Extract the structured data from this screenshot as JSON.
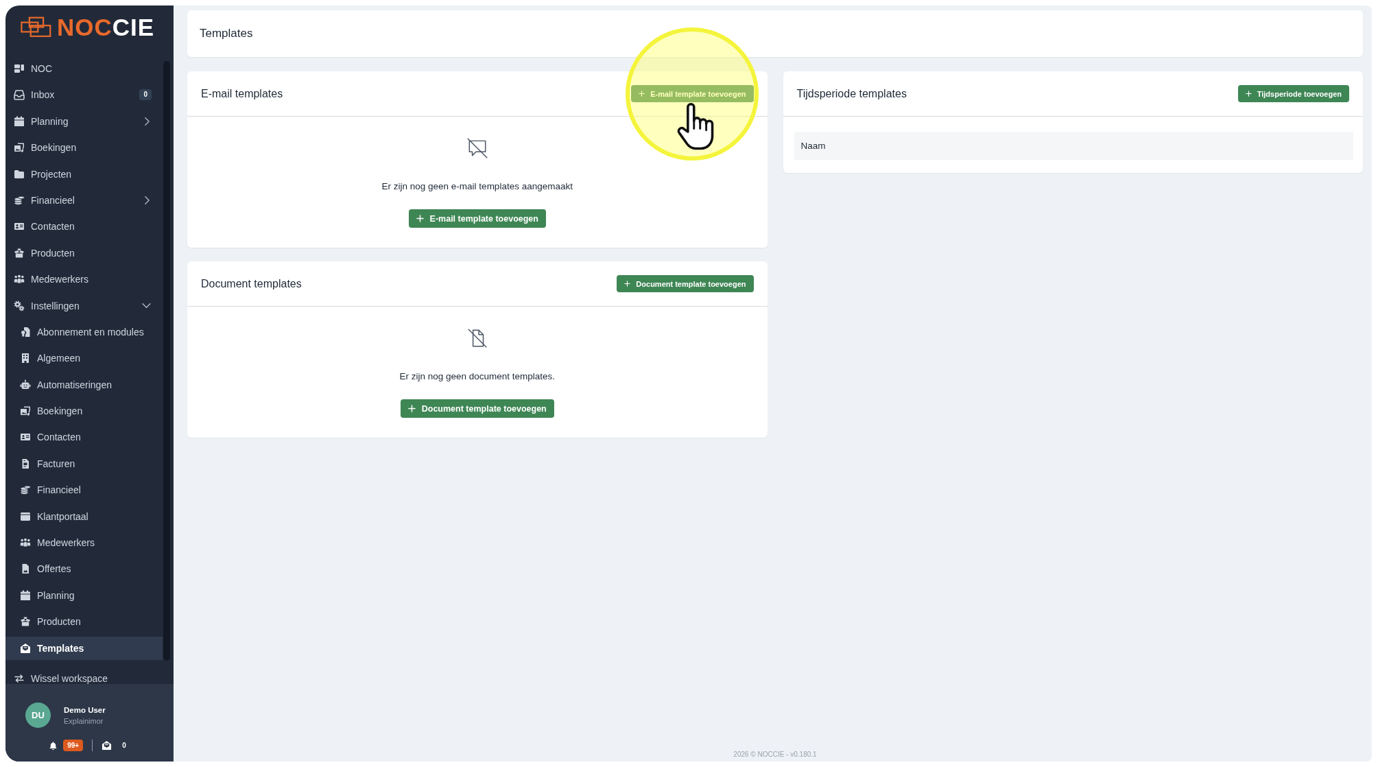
{
  "logo": {
    "accent": "NOC",
    "rest": "CIE"
  },
  "sidebar": {
    "items": [
      {
        "label": "NOC",
        "kind": "link",
        "selected": false
      },
      {
        "label": "Inbox",
        "kind": "link",
        "selected": false,
        "badge": "0"
      },
      {
        "label": "Planning",
        "kind": "group",
        "selected": false,
        "expanded": false
      },
      {
        "label": "Boekingen",
        "kind": "link",
        "selected": false
      },
      {
        "label": "Projecten",
        "kind": "link",
        "selected": false
      },
      {
        "label": "Financieel",
        "kind": "group",
        "selected": false,
        "expanded": false
      },
      {
        "label": "Contacten",
        "kind": "link",
        "selected": false
      },
      {
        "label": "Producten",
        "kind": "link",
        "selected": false
      },
      {
        "label": "Medewerkers",
        "kind": "link",
        "selected": false
      },
      {
        "label": "Instellingen",
        "kind": "group",
        "selected": false,
        "expanded": true,
        "children": [
          {
            "label": "Abonnement en modules",
            "selected": false
          },
          {
            "label": "Algemeen",
            "selected": false
          },
          {
            "label": "Automatiseringen",
            "selected": false
          },
          {
            "label": "Boekingen",
            "selected": false
          },
          {
            "label": "Contacten",
            "selected": false
          },
          {
            "label": "Facturen",
            "selected": false
          },
          {
            "label": "Financieel",
            "selected": false
          },
          {
            "label": "Klantportaal",
            "selected": false
          },
          {
            "label": "Medewerkers",
            "selected": false
          },
          {
            "label": "Offertes",
            "selected": false
          },
          {
            "label": "Planning",
            "selected": false
          },
          {
            "label": "Producten",
            "selected": false
          },
          {
            "label": "Templates",
            "selected": true
          }
        ]
      }
    ],
    "workspace_switch": "Wissel workspace",
    "user": {
      "initials": "DU",
      "name": "Demo User",
      "organization": "Explainimor",
      "notification_count": "99+",
      "message_count": "0"
    }
  },
  "page_title": "Templates",
  "columns": [
    {
      "cards": [
        {
          "kind": "empty",
          "title": "E-mail templates",
          "action": "E-mail template toevoegen",
          "action_highlighted": true,
          "message": "Er zijn nog geen e-mail templates aangemaakt",
          "button": "E-mail template toevoegen"
        },
        {
          "kind": "empty",
          "title": "Document templates",
          "action": "Document template toevoegen",
          "action_highlighted": false,
          "message": "Er zijn nog geen document templates.",
          "button": "Document template toevoegen"
        }
      ]
    },
    {
      "cards": [
        {
          "kind": "table",
          "title": "Tijdsperiode templates",
          "action": "Tijdsperiode toevoegen",
          "action_highlighted": false,
          "table": {
            "columns": [
              "Naam"
            ]
          }
        }
      ]
    }
  ],
  "footer": "2026 © NOCCIE - v0.180.1"
}
